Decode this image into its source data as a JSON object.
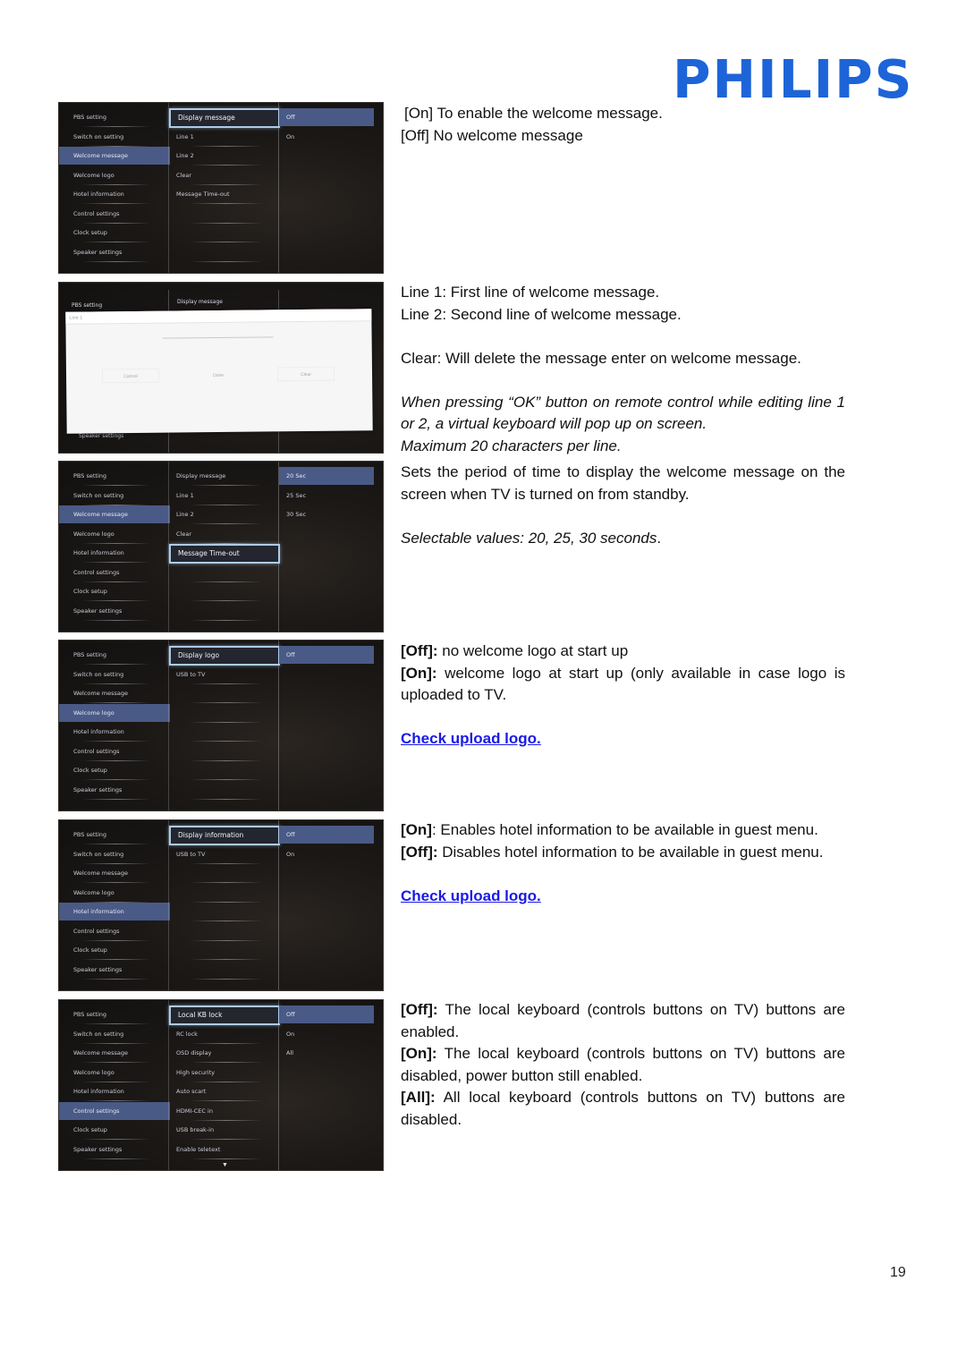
{
  "brand": {
    "logo_text": "PHILIPS",
    "logo_color": "#1d64d8"
  },
  "page_number": "19",
  "link_color": "#1a1ae8",
  "left_menu": [
    "PBS setting",
    "Switch on setting",
    "Welcome message",
    "Welcome logo",
    "Hotel information",
    "Control settings",
    "Clock setup",
    "Speaker settings"
  ],
  "screens": [
    {
      "id": "welcome-display-message",
      "selected_left": "Welcome message",
      "middle": [
        "Display message",
        "Line 1",
        "Line 2",
        "Clear",
        "Message Time-out",
        "",
        "",
        ""
      ],
      "focused_middle": "Display message",
      "options": [
        "Off",
        "On"
      ],
      "selected_option": "Off"
    },
    {
      "id": "welcome-line-edit-dialog",
      "header_left": "PBS setting",
      "header_middle": "Display message",
      "footer_left": "Speaker settings",
      "dialog": {
        "title": "Line 1",
        "buttons": [
          "Cancel",
          "Done",
          "Clear"
        ]
      }
    },
    {
      "id": "welcome-message-timeout",
      "selected_left": "Welcome message",
      "middle": [
        "Display message",
        "Line 1",
        "Line 2",
        "Clear",
        "Message Time-out",
        "",
        "",
        ""
      ],
      "focused_middle": "Message Time-out",
      "options": [
        "20 Sec",
        "25 Sec",
        "30 Sec"
      ],
      "selected_option": "20 Sec"
    },
    {
      "id": "welcome-logo",
      "selected_left": "Welcome logo",
      "middle": [
        "Display logo",
        "USB to TV",
        "",
        "",
        "",
        "",
        "",
        ""
      ],
      "focused_middle": "Display logo",
      "options": [
        "Off"
      ],
      "selected_option": "Off"
    },
    {
      "id": "hotel-information",
      "selected_left": "Hotel information",
      "middle": [
        "Display information",
        "USB to TV",
        "",
        "",
        "",
        "",
        "",
        ""
      ],
      "focused_middle": "Display information",
      "options": [
        "Off",
        "On"
      ],
      "selected_option": "Off"
    },
    {
      "id": "control-settings",
      "selected_left": "Control settings",
      "middle": [
        "Local KB lock",
        "RC lock",
        "OSD display",
        "High security",
        "Auto scart",
        "HDMI-CEC in",
        "USB break-in",
        "Enable teletext"
      ],
      "focused_middle": "Local KB lock",
      "options": [
        "Off",
        "On",
        "All"
      ],
      "selected_option": "Off",
      "more_indicator": "▼"
    }
  ],
  "descriptions": {
    "display_message": {
      "on": "[On] To enable the welcome message.",
      "off": "[Off] No welcome message"
    },
    "lines": {
      "line1": "Line 1: First line of welcome message.",
      "line2": "Line 2: Second line of welcome message.",
      "clear": "Clear: Will delete the message enter on welcome message.",
      "note": "When pressing “OK” button on remote control while editing line 1 or 2, a virtual keyboard will pop up on screen.",
      "max": "Maximum 20 characters per line."
    },
    "timeout": {
      "text": "Sets the period of time to display the welcome message on the screen when TV is turned on from standby.",
      "values": "Selectable values: 20, 25, 30 seconds",
      "values_end": "."
    },
    "logo": {
      "off_label": "[Off]:",
      "off_text": " no welcome logo at start up",
      "on_label": "[On]:",
      "on_text": " welcome logo at start up (only available in case logo is uploaded to TV.",
      "link": "Check upload logo."
    },
    "hotel": {
      "on_label": "[On]",
      "on_text": ": Enables hotel information to be available in guest menu.",
      "off_label": "[Off]:",
      "off_text": " Disables hotel information to be available in guest menu.",
      "link": "Check upload logo."
    },
    "kb_lock": {
      "off_label": "[Off]:",
      "off_text": " The local keyboard (controls buttons on TV) buttons are enabled.",
      "on_label": "[On]:",
      "on_text": " The local keyboard (controls buttons on TV) buttons are disabled, power button still enabled.",
      "all_label": "[All]:",
      "all_text": " All local keyboard (controls buttons on TV) buttons are disabled."
    }
  }
}
